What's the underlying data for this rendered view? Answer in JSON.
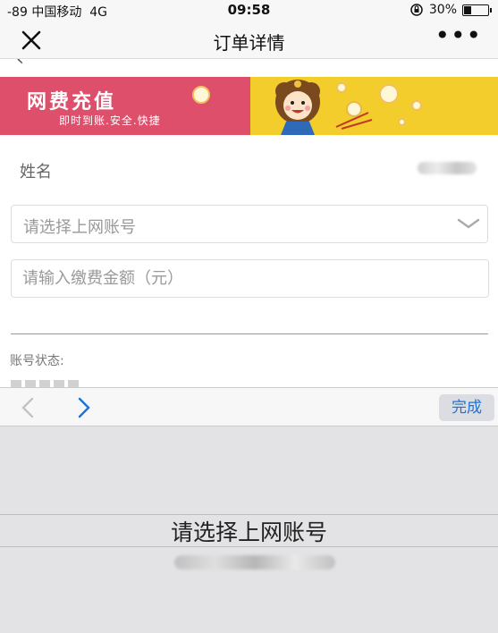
{
  "status_bar": {
    "carrier": "-89 中国移动",
    "network": "4G",
    "time": "09:58",
    "battery": "30%",
    "battery_level": 0.3
  },
  "nav": {
    "title": "订单详情",
    "close_icon": "close-icon",
    "more_icon": "more-icon",
    "more_label": "•••"
  },
  "banner": {
    "title": "网费充值",
    "subtitle": "即时到账.安全.快捷",
    "colors": {
      "left": "#dd4f6b",
      "right": "#f3cd2b"
    }
  },
  "form": {
    "name_label": "姓名",
    "account_select_placeholder": "请选择上网账号",
    "amount_placeholder": "请输入缴费金额（元）",
    "account_status_label": "账号状态:"
  },
  "picker": {
    "prev_icon": "chevron-left-icon",
    "next_icon": "chevron-right-icon",
    "done_label": "完成",
    "selected_option": "请选择上网账号",
    "accent_color": "#1a73d9"
  }
}
